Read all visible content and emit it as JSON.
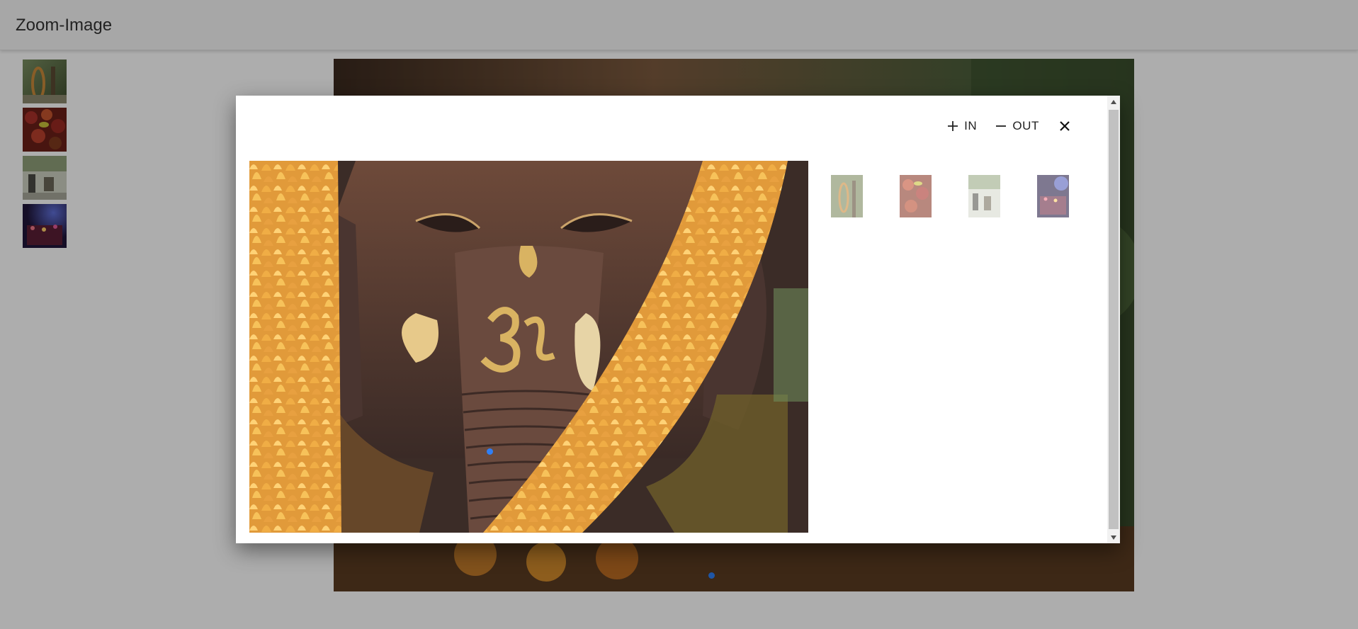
{
  "app": {
    "title": "Zoom-Image"
  },
  "thumbnails": [
    {
      "name": "temple-tree-thumbnail"
    },
    {
      "name": "red-flowers-thumbnail"
    },
    {
      "name": "street-scene-thumbnail"
    },
    {
      "name": "night-lights-thumbnail"
    }
  ],
  "dialog": {
    "zoom_in_label": "IN",
    "zoom_out_label": "OUT",
    "icons": {
      "zoom_in": "plus-icon",
      "zoom_out": "minus-icon",
      "close": "close-icon"
    },
    "image_subject": "ganesha-statue-with-marigold-garlands",
    "thumbnail_opacity": 0.6
  },
  "colors": {
    "accent_dot": "#2f7ff5",
    "overlay": "rgba(0,0,0,0.32)"
  }
}
